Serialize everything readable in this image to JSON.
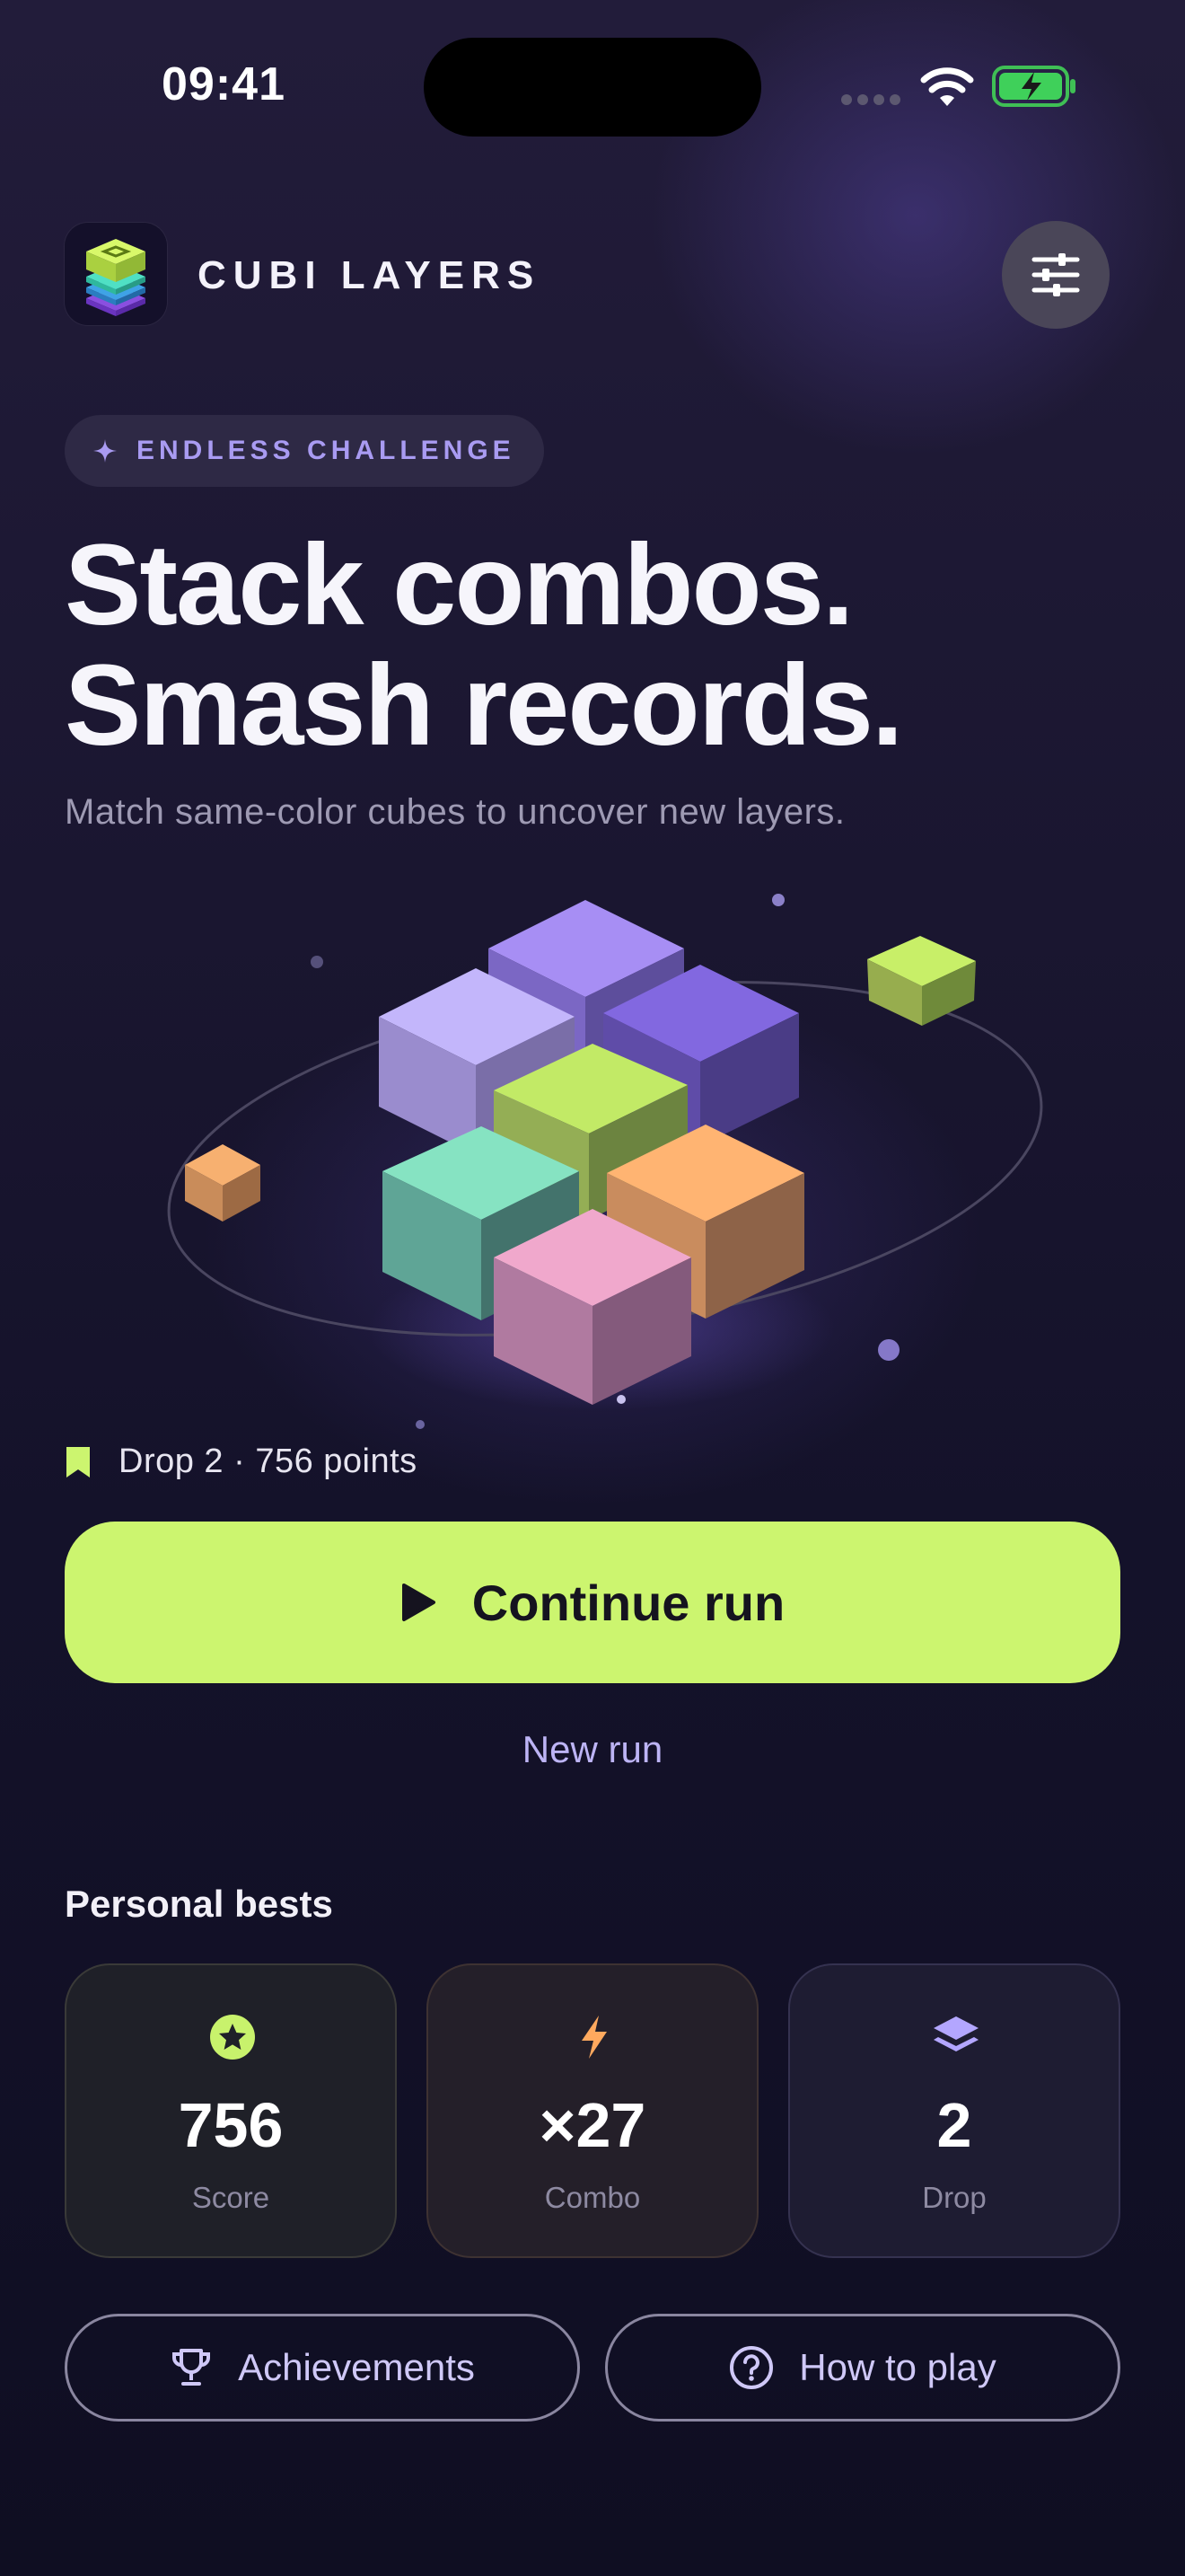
{
  "status_bar": {
    "time": "09:41"
  },
  "header": {
    "app_name": "CUBI LAYERS",
    "icons": [
      "app-logo-icon",
      "sliders-icon"
    ]
  },
  "badge": {
    "label": "ENDLESS CHALLENGE",
    "icon": "sparkle-icon"
  },
  "hero": {
    "headline_line1": "Stack combos.",
    "headline_line2": "Smash records.",
    "subtitle": "Match same-color cubes to uncover new layers."
  },
  "saved_run": {
    "text": "Drop 2 · 756 points",
    "icon": "bookmark-icon"
  },
  "actions": {
    "continue_label": "Continue run",
    "new_run_label": "New run"
  },
  "personal_bests": {
    "title": "Personal bests",
    "cards": [
      {
        "value": "756",
        "label": "Score",
        "icon": "star-badge-icon",
        "color": "#c8f26c"
      },
      {
        "value": "×27",
        "label": "Combo",
        "icon": "lightning-icon",
        "color": "#ffa95e"
      },
      {
        "value": "2",
        "label": "Drop",
        "icon": "layers-icon",
        "color": "#b3a6ff"
      }
    ]
  },
  "footer": {
    "achievements_label": "Achievements",
    "how_to_play_label": "How to play"
  },
  "colors": {
    "accent_lime": "#ccf56f",
    "accent_purple": "#a99bf2",
    "background": "#16132c"
  }
}
